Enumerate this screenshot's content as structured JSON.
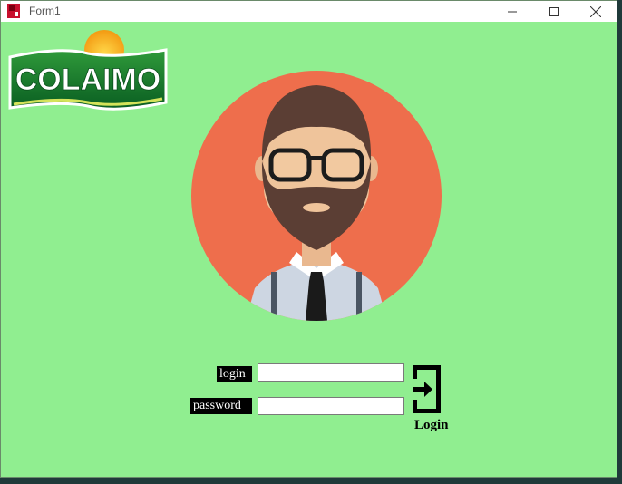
{
  "window": {
    "title": "Form1",
    "controls": {
      "minimize": "minimize-icon",
      "maximize": "maximize-icon",
      "close": "close-icon"
    }
  },
  "logo": {
    "text": "COLAIMO",
    "icon": "colaimo-logo"
  },
  "avatar": {
    "icon": "bearded-man-avatar"
  },
  "form": {
    "login_label": "login",
    "login_value": "",
    "password_label": "password",
    "password_value": ""
  },
  "login_button": {
    "label": "Login",
    "icon": "sign-in-icon"
  },
  "colors": {
    "background": "#90ee90",
    "avatar_circle": "#ee6e4c",
    "label_bg": "#000000",
    "logo_green": "#0b6b2a"
  }
}
